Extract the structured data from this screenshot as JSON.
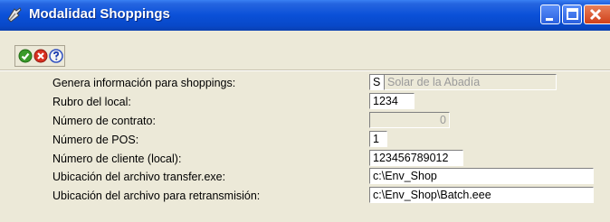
{
  "window": {
    "title": "Modalidad Shoppings"
  },
  "toolbar": {
    "icons": [
      "accept-icon",
      "cancel-icon",
      "help-icon"
    ]
  },
  "form": {
    "genera": {
      "label": "Genera información para shoppings:",
      "flag": "S",
      "name": "Solar de la Abadía"
    },
    "rubro": {
      "label": "Rubro del local:",
      "value": "1234"
    },
    "contrato": {
      "label": "Número de contrato:",
      "value": "0"
    },
    "pos": {
      "label": "Número de POS:",
      "value": "1"
    },
    "cliente": {
      "label": "Número de cliente (local):",
      "value": "123456789012"
    },
    "transfer": {
      "label": "Ubicación del archivo transfer.exe:",
      "value": "c:\\Env_Shop"
    },
    "retrans": {
      "label": "Ubicación del archivo para retransmisión:",
      "value": "c:\\Env_Shop\\Batch.eee"
    }
  },
  "colors": {
    "titlebar": "#0a50d8",
    "window_bg": "#ece9d8",
    "close_button": "#d0401a"
  }
}
